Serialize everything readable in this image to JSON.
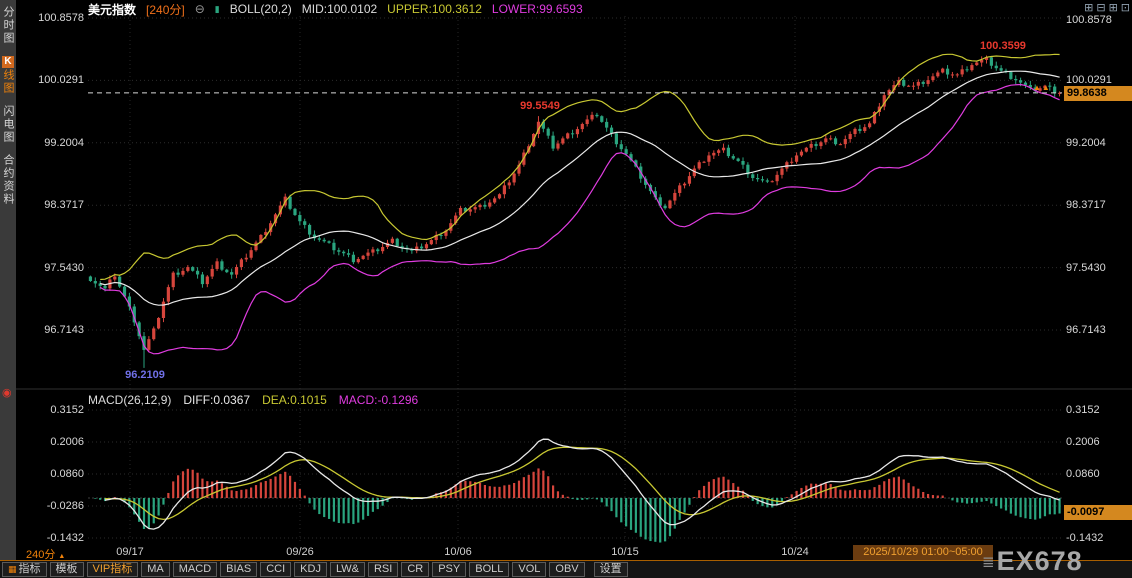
{
  "header": {
    "symbol": "美元指数",
    "period": "[240分]",
    "boll_label": "BOLL(20,2)",
    "mid": "MID:100.0102",
    "upper": "UPPER:100.3612",
    "lower": "LOWER:99.6593"
  },
  "icons": {
    "collapse": "⊖",
    "candle": "▮",
    "layout": [
      "⊞",
      "⊟",
      "⊞",
      "⊡"
    ],
    "gear_dot": "◉",
    "up_arrows": "▲▲",
    "period_arrow": "▲",
    "toolbar_grid": "▦",
    "logo_bars": "≣"
  },
  "sidebar": {
    "items": [
      {
        "label": "分时图"
      },
      {
        "badge": "K",
        "label": "线图"
      },
      {
        "label": "闪电图"
      },
      {
        "label": "合约资料"
      }
    ]
  },
  "main_axis": {
    "labels": [
      "100.8578",
      "100.0291",
      "99.2004",
      "98.3717",
      "97.5430",
      "96.7143"
    ]
  },
  "annotations": {
    "high": "100.3599",
    "peak": "99.5549",
    "low": "96.2109",
    "last_price": "99.8638"
  },
  "macd_header": {
    "label": "MACD(26,12,9)",
    "diff": "DIFF:0.0367",
    "dea": "DEA:0.1015",
    "macd": "MACD:-0.1296"
  },
  "macd_axis": {
    "labels": [
      "0.3152",
      "0.2006",
      "0.0860",
      "-0.0286",
      "-0.1432"
    ],
    "badge": "-0.0097"
  },
  "xaxis": {
    "period": "240分",
    "dates": [
      "09/17",
      "09/26",
      "10/06",
      "10/15",
      "10/24"
    ],
    "current": "2025/10/29 01:00~05:00"
  },
  "toolbar": {
    "items": [
      "指标",
      "模板",
      "VIP指标",
      "MA",
      "MACD",
      "BIAS",
      "CCI",
      "KDJ",
      "LW&",
      "RSI",
      "CR",
      "PSY",
      "BOLL",
      "VOL",
      "OBV",
      "设置"
    ]
  },
  "watermark": "EX678",
  "colors": {
    "up": "#d6453c",
    "down": "#2aa57f",
    "boll_upper": "#c8c832",
    "boll_mid": "#e8e8e8",
    "boll_lower": "#e03ce0",
    "diff_line": "#e8e8e8",
    "dea_line": "#c8c832",
    "accent": "#f0820a",
    "badge_bg": "#d4881f",
    "grid": "#2c2c2c"
  },
  "chart_data": {
    "type": "candlestick",
    "title": "美元指数 240分 K线 + BOLL(20,2) + MACD(26,12,9)",
    "ylim": [
      96.7143,
      100.8578
    ],
    "y_ticks": [
      100.8578,
      100.0291,
      99.2004,
      98.3717,
      97.543,
      96.7143
    ],
    "x_tick_dates": [
      "09/17",
      "09/26",
      "10/06",
      "10/15",
      "10/24",
      "2025/10/29 01:00~05:00"
    ],
    "n_bars": 200,
    "close_waypoints": [
      [
        0,
        97.4
      ],
      [
        3,
        97.25
      ],
      [
        5,
        97.45
      ],
      [
        7,
        97.15
      ],
      [
        9,
        96.85
      ],
      [
        11,
        96.45
      ],
      [
        13,
        96.7
      ],
      [
        15,
        97.1
      ],
      [
        17,
        97.45
      ],
      [
        20,
        97.55
      ],
      [
        23,
        97.35
      ],
      [
        26,
        97.6
      ],
      [
        29,
        97.45
      ],
      [
        32,
        97.7
      ],
      [
        35,
        97.95
      ],
      [
        38,
        98.25
      ],
      [
        40,
        98.45
      ],
      [
        43,
        98.15
      ],
      [
        46,
        97.95
      ],
      [
        50,
        97.8
      ],
      [
        54,
        97.65
      ],
      [
        58,
        97.75
      ],
      [
        62,
        97.9
      ],
      [
        66,
        97.75
      ],
      [
        70,
        97.9
      ],
      [
        73,
        98.05
      ],
      [
        76,
        98.3
      ],
      [
        80,
        98.35
      ],
      [
        84,
        98.5
      ],
      [
        88,
        98.9
      ],
      [
        92,
        99.48
      ],
      [
        95,
        99.15
      ],
      [
        98,
        99.3
      ],
      [
        101,
        99.45
      ],
      [
        104,
        99.58
      ],
      [
        107,
        99.3
      ],
      [
        110,
        99.05
      ],
      [
        113,
        98.75
      ],
      [
        116,
        98.45
      ],
      [
        118,
        98.35
      ],
      [
        121,
        98.6
      ],
      [
        124,
        98.85
      ],
      [
        127,
        99.05
      ],
      [
        130,
        99.1
      ],
      [
        133,
        98.95
      ],
      [
        136,
        98.75
      ],
      [
        139,
        98.65
      ],
      [
        142,
        98.85
      ],
      [
        145,
        99.05
      ],
      [
        148,
        99.15
      ],
      [
        151,
        99.25
      ],
      [
        154,
        99.2
      ],
      [
        157,
        99.35
      ],
      [
        160,
        99.45
      ],
      [
        163,
        99.85
      ],
      [
        166,
        100.0
      ],
      [
        169,
        99.95
      ],
      [
        172,
        100.05
      ],
      [
        175,
        100.15
      ],
      [
        178,
        100.1
      ],
      [
        181,
        100.25
      ],
      [
        184,
        100.3
      ],
      [
        187,
        100.15
      ],
      [
        190,
        100.05
      ],
      [
        193,
        99.9
      ],
      [
        196,
        99.95
      ],
      [
        199,
        99.8638
      ]
    ],
    "key_points": {
      "low": {
        "index": 11,
        "price": 96.2109
      },
      "peak1": {
        "index": 92,
        "price": 99.5549
      },
      "high": {
        "index": 184,
        "price": 100.3599
      },
      "last_close": 99.8638
    },
    "indicators": {
      "boll": {
        "period": 20,
        "mult": 2,
        "mid": 100.0102,
        "upper": 100.3612,
        "lower": 99.6593
      },
      "macd": {
        "fast": 12,
        "slow": 26,
        "signal": 9,
        "diff": 0.0367,
        "dea": 0.1015,
        "hist": -0.1296,
        "axis_badge": -0.0097,
        "y_ticks": [
          0.3152,
          0.2006,
          0.086,
          -0.0286,
          -0.1432
        ]
      }
    }
  }
}
